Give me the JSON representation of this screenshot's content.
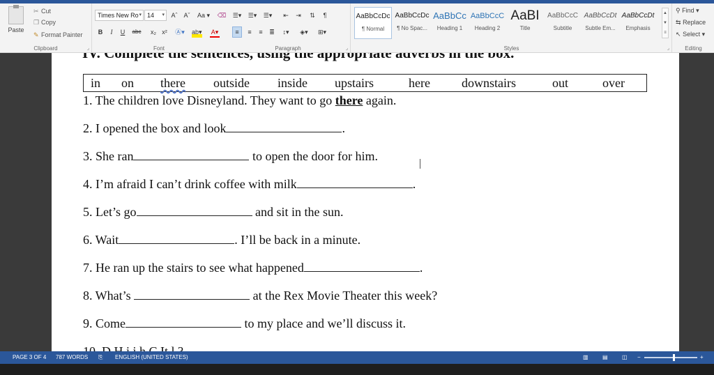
{
  "clipboard": {
    "paste": "Paste",
    "cut": "Cut",
    "copy": "Copy",
    "format_painter": "Format Painter",
    "group_label": "Clipboard"
  },
  "font": {
    "font_name": "Times New Ro",
    "font_size": "14",
    "grow": "Aˆ",
    "shrink": "Aˇ",
    "case": "Aa",
    "bold": "B",
    "italic": "I",
    "underline": "U",
    "strike": "abc",
    "subscript": "x₂",
    "superscript": "x²",
    "group_label": "Font"
  },
  "paragraph": {
    "group_label": "Paragraph"
  },
  "styles": {
    "group_label": "Styles",
    "items": [
      {
        "preview": "AaBbCcDc",
        "name": "¶ Normal"
      },
      {
        "preview": "AaBbCcDc",
        "name": "¶ No Spac..."
      },
      {
        "preview": "AaBbCc",
        "name": "Heading 1"
      },
      {
        "preview": "AaBbCcC",
        "name": "Heading 2"
      },
      {
        "preview": "AaBI",
        "name": "Title"
      },
      {
        "preview": "AaBbCcC",
        "name": "Subtitle"
      },
      {
        "preview": "AaBbCcDt",
        "name": "Subtle Em..."
      },
      {
        "preview": "AaBbCcDt",
        "name": "Emphasis"
      }
    ]
  },
  "editing": {
    "find": "Find",
    "replace": "Replace",
    "select": "Select",
    "group_label": "Editing"
  },
  "document": {
    "heading": "IV. Complete the sentences, using the appropriate adverbs in the box.",
    "word_box": [
      "in",
      "on",
      "there",
      "outside",
      "inside",
      "upstairs",
      "here",
      "downstairs",
      "out",
      "over"
    ],
    "sentences": [
      {
        "before": "1. The children love Disneyland. They want to go ",
        "answer": "there",
        "after": " again."
      },
      {
        "before": "2. I opened the box and look",
        "after": "."
      },
      {
        "before": "3. She ran",
        "after": " to open the door for him."
      },
      {
        "before": "4. I’m afraid I can’t drink coffee with milk",
        "after": "."
      },
      {
        "before": "5. Let’s go",
        "after": " and sit in the sun."
      },
      {
        "before": "6. Wait",
        "after": ". I’ll be back in a minute."
      },
      {
        "before": "7. He ran up the stairs to see what happened",
        "after": "."
      },
      {
        "before": "8. What’s ",
        "after": " at the Rex Movie Theater this week?"
      },
      {
        "before": "9. Come",
        "after": " to my place and we’ll discuss it."
      }
    ],
    "partial_line": "10. D H               i           i h        C  It l          ?"
  },
  "status": {
    "page": "PAGE 3 OF 4",
    "words": "787 WORDS",
    "language": "ENGLISH (UNITED STATES)"
  },
  "colors": {
    "accent": "#2b579a",
    "ribbon_bg": "#f3f3f3",
    "app_bg": "#3a3a3a"
  }
}
